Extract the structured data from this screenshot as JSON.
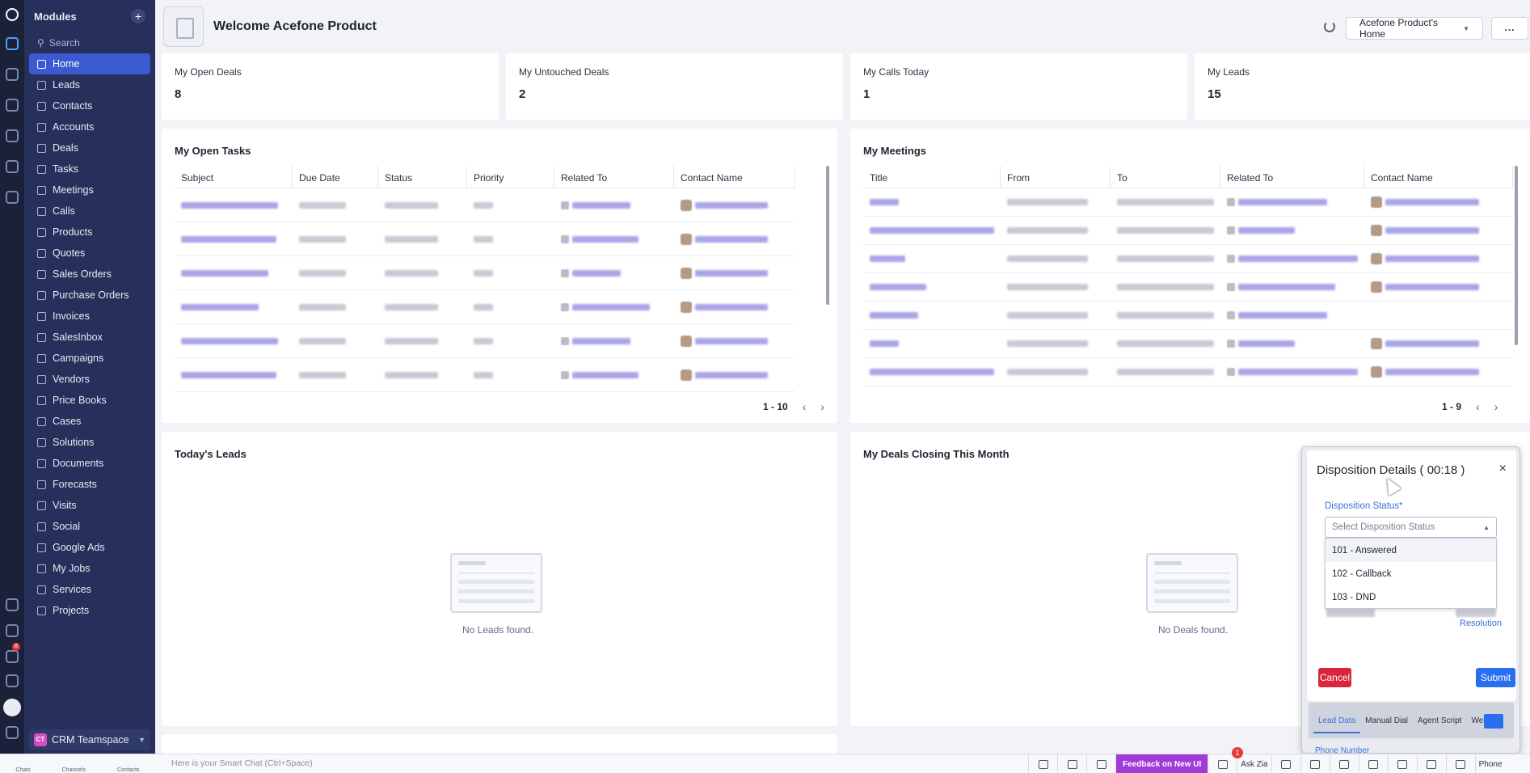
{
  "sidebar": {
    "title": "Modules",
    "add_symbol": "+",
    "search_placeholder": "Search",
    "items": [
      {
        "label": "Home",
        "icon": "home-icon"
      },
      {
        "label": "Leads",
        "icon": "leads-icon"
      },
      {
        "label": "Contacts",
        "icon": "contacts-icon"
      },
      {
        "label": "Accounts",
        "icon": "accounts-icon"
      },
      {
        "label": "Deals",
        "icon": "deals-icon"
      },
      {
        "label": "Tasks",
        "icon": "tasks-icon"
      },
      {
        "label": "Meetings",
        "icon": "meetings-icon"
      },
      {
        "label": "Calls",
        "icon": "calls-icon"
      },
      {
        "label": "Products",
        "icon": "products-icon"
      },
      {
        "label": "Quotes",
        "icon": "quotes-icon"
      },
      {
        "label": "Sales Orders",
        "icon": "sales-orders-icon"
      },
      {
        "label": "Purchase Orders",
        "icon": "purchase-orders-icon"
      },
      {
        "label": "Invoices",
        "icon": "invoices-icon"
      },
      {
        "label": "SalesInbox",
        "icon": "salesinbox-icon"
      },
      {
        "label": "Campaigns",
        "icon": "campaigns-icon"
      },
      {
        "label": "Vendors",
        "icon": "vendors-icon"
      },
      {
        "label": "Price Books",
        "icon": "price-books-icon"
      },
      {
        "label": "Cases",
        "icon": "cases-icon"
      },
      {
        "label": "Solutions",
        "icon": "solutions-icon"
      },
      {
        "label": "Documents",
        "icon": "documents-icon"
      },
      {
        "label": "Forecasts",
        "icon": "forecasts-icon"
      },
      {
        "label": "Visits",
        "icon": "visits-icon"
      },
      {
        "label": "Social",
        "icon": "social-icon"
      },
      {
        "label": "Google Ads",
        "icon": "google-ads-icon"
      },
      {
        "label": "My Jobs",
        "icon": "my-jobs-icon"
      },
      {
        "label": "Services",
        "icon": "services-icon"
      },
      {
        "label": "Projects",
        "icon": "projects-icon"
      }
    ],
    "team": {
      "badge": "CT",
      "label": "CRM Teamspace"
    }
  },
  "rail": {
    "notification_count": "8"
  },
  "header": {
    "welcome": "Welcome Acefone Product",
    "home_selector": "Acefone Product's Home",
    "more": "..."
  },
  "stats": [
    {
      "label": "My Open Deals",
      "value": "8"
    },
    {
      "label": "My Untouched Deals",
      "value": "2"
    },
    {
      "label": "My Calls Today",
      "value": "1"
    },
    {
      "label": "My Leads",
      "value": "15"
    }
  ],
  "tasks": {
    "title": "My Open Tasks",
    "columns": [
      "Subject",
      "Due Date",
      "Status",
      "Priority",
      "Related To",
      "Contact Name"
    ],
    "pager": "1 - 10"
  },
  "meetings": {
    "title": "My Meetings",
    "columns": [
      "Title",
      "From",
      "To",
      "Related To",
      "Contact Name"
    ],
    "pager": "1 - 9"
  },
  "leads": {
    "title": "Today's Leads",
    "empty": "No Leads found."
  },
  "deals": {
    "title": "My Deals Closing This Month",
    "empty": "No Deals found."
  },
  "disposition": {
    "title": "Disposition Details ( 00:18 )",
    "close": "×",
    "status_label": "Disposition Status*",
    "placeholder": "Select Disposition Status",
    "options": [
      "101 - Answered",
      "102 - Callback",
      "103 - DND"
    ],
    "resolution": "Resolution",
    "cancel": "Cancel",
    "submit": "Submit",
    "tabs": [
      "Lead Data",
      "Manual Dial",
      "Agent Script",
      "Web"
    ],
    "phone_label": "Phone Number"
  },
  "bottombar": {
    "left": [
      "Chats",
      "Channels",
      "Contacts"
    ],
    "chat_placeholder": "Here is your Smart Chat (Ctrl+Space)",
    "feedback": "Feedback on New UI",
    "feedback_count": "1",
    "ask_zia": "Ask Zia",
    "phone": "Phone"
  },
  "colors": {
    "sidebar_bg": "#27305a",
    "active_item": "#3b5ad1",
    "cancel_red": "#d9263c",
    "submit_blue": "#2a6ef0",
    "feedback_purple": "#a23ad8",
    "link_blue": "#3d6fd8"
  }
}
